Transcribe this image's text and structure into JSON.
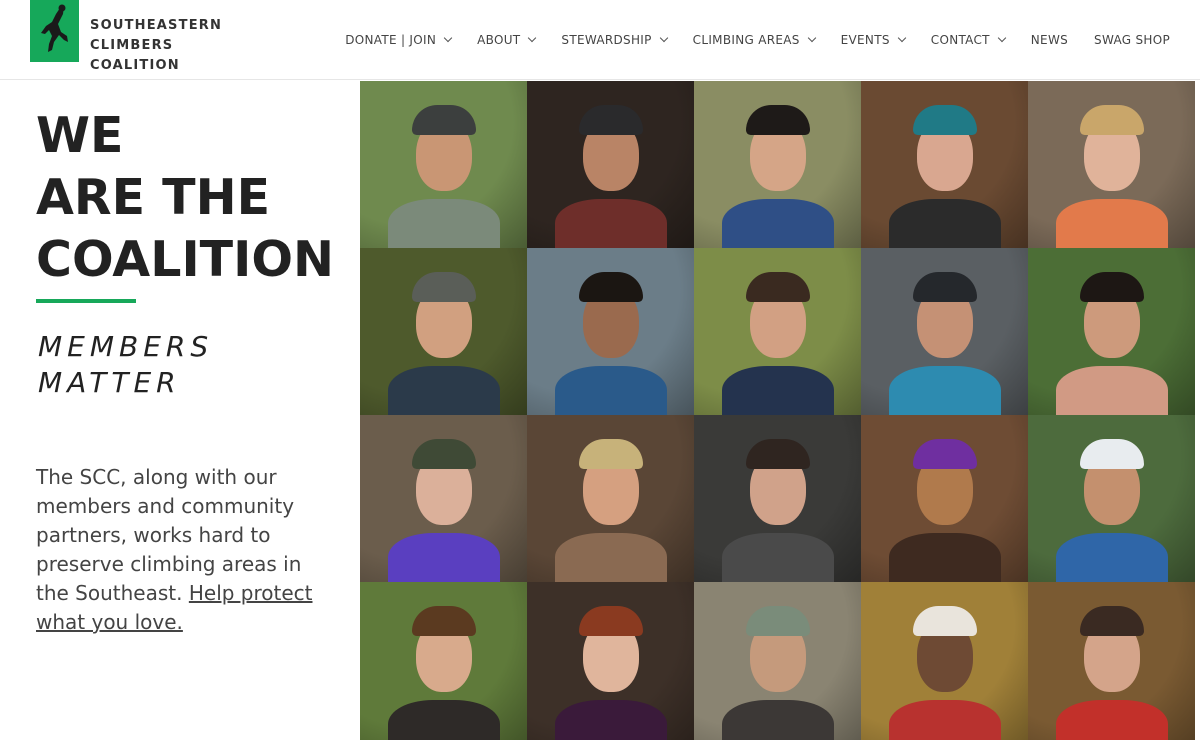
{
  "logo": {
    "lines": [
      "SOUTHEASTERN",
      "CLIMBERS",
      "COALITION"
    ],
    "brand_color": "#16a85a",
    "icon": "climber-icon"
  },
  "nav": {
    "items": [
      {
        "label": "DONATE | JOIN",
        "dropdown": true
      },
      {
        "label": "ABOUT",
        "dropdown": true
      },
      {
        "label": "STEWARDSHIP",
        "dropdown": true
      },
      {
        "label": "CLIMBING AREAS",
        "dropdown": true
      },
      {
        "label": "EVENTS",
        "dropdown": true
      },
      {
        "label": "CONTACT",
        "dropdown": true
      },
      {
        "label": "NEWS",
        "dropdown": false
      },
      {
        "label": "SWAG SHOP",
        "dropdown": false
      }
    ]
  },
  "hero": {
    "lines": [
      "WE",
      "ARE THE",
      "COALITION"
    ],
    "accent_color": "#17a85a"
  },
  "tagline": {
    "lines": [
      "MEMBERS",
      "MATTER"
    ]
  },
  "blurb": {
    "text": "The SCC, along with our members and community partners, works hard to preserve climbing areas in the Southeast. ",
    "link": "Help protect what you love."
  },
  "grid": {
    "tiles": [
      {
        "bg": "#6f8a4e",
        "face": "#c99674",
        "hat": "#3c3f3e",
        "body": "#7b8a7a"
      },
      {
        "bg": "#2e2520",
        "face": "#b98466",
        "hat": "#2a2a2c",
        "body": "#6e2e2a"
      },
      {
        "bg": "#8a8d63",
        "face": "#d5a587",
        "hat": "#1e1a18",
        "body": "#2f4f86"
      },
      {
        "bg": "#6a4a32",
        "face": "#d9a790",
        "hat": "#207a86",
        "body": "#2b2b2b"
      },
      {
        "bg": "#7b6a58",
        "face": "#e0b39a",
        "hat": "#c9a66a",
        "body": "#e27a4b"
      },
      {
        "bg": "#4e5a2c",
        "face": "#d1a080",
        "hat": "#5a5e58",
        "body": "#2b3a4a"
      },
      {
        "bg": "#6b7d88",
        "face": "#9a6a4e",
        "hat": "#1b1612",
        "body": "#2a5a8a"
      },
      {
        "bg": "#7d8d48",
        "face": "#d2a083",
        "hat": "#3a2a20",
        "body": "#24334e"
      },
      {
        "bg": "#5a5f63",
        "face": "#c59175",
        "hat": "#25282c",
        "body": "#2d8bb0"
      },
      {
        "bg": "#4c6e36",
        "face": "#cd9a7c",
        "hat": "#1d1714",
        "body": "#d19a84"
      },
      {
        "bg": "#6b5d4c",
        "face": "#dbb09a",
        "hat": "#3f4a36",
        "body": "#5a3fc0"
      },
      {
        "bg": "#5a4636",
        "face": "#d5a080",
        "hat": "#c7b27a",
        "body": "#8a6a52"
      },
      {
        "bg": "#3a3a38",
        "face": "#d0a28a",
        "hat": "#2f2520",
        "body": "#4a4a4a"
      },
      {
        "bg": "#6e4c34",
        "face": "#b07a4c",
        "hat": "#6f2fa0",
        "body": "#3e2a20"
      },
      {
        "bg": "#4d6b3d",
        "face": "#c4906e",
        "hat": "#e8ecef",
        "body": "#2f66a8"
      },
      {
        "bg": "#5f7a3a",
        "face": "#d8aa8c",
        "hat": "#5b3a20",
        "body": "#2e2a28"
      },
      {
        "bg": "#3d3028",
        "face": "#e0b59c",
        "hat": "#8a3a20",
        "body": "#3a1a3a"
      },
      {
        "bg": "#8a8472",
        "face": "#c59a7c",
        "hat": "#7a8c7a",
        "body": "#3c3836"
      },
      {
        "bg": "#a08038",
        "face": "#6e4a34",
        "hat": "#e9e4dc",
        "body": "#b8322f"
      },
      {
        "bg": "#7a5a32",
        "face": "#d4a48a",
        "hat": "#3a2a22",
        "body": "#c2302a"
      }
    ]
  }
}
